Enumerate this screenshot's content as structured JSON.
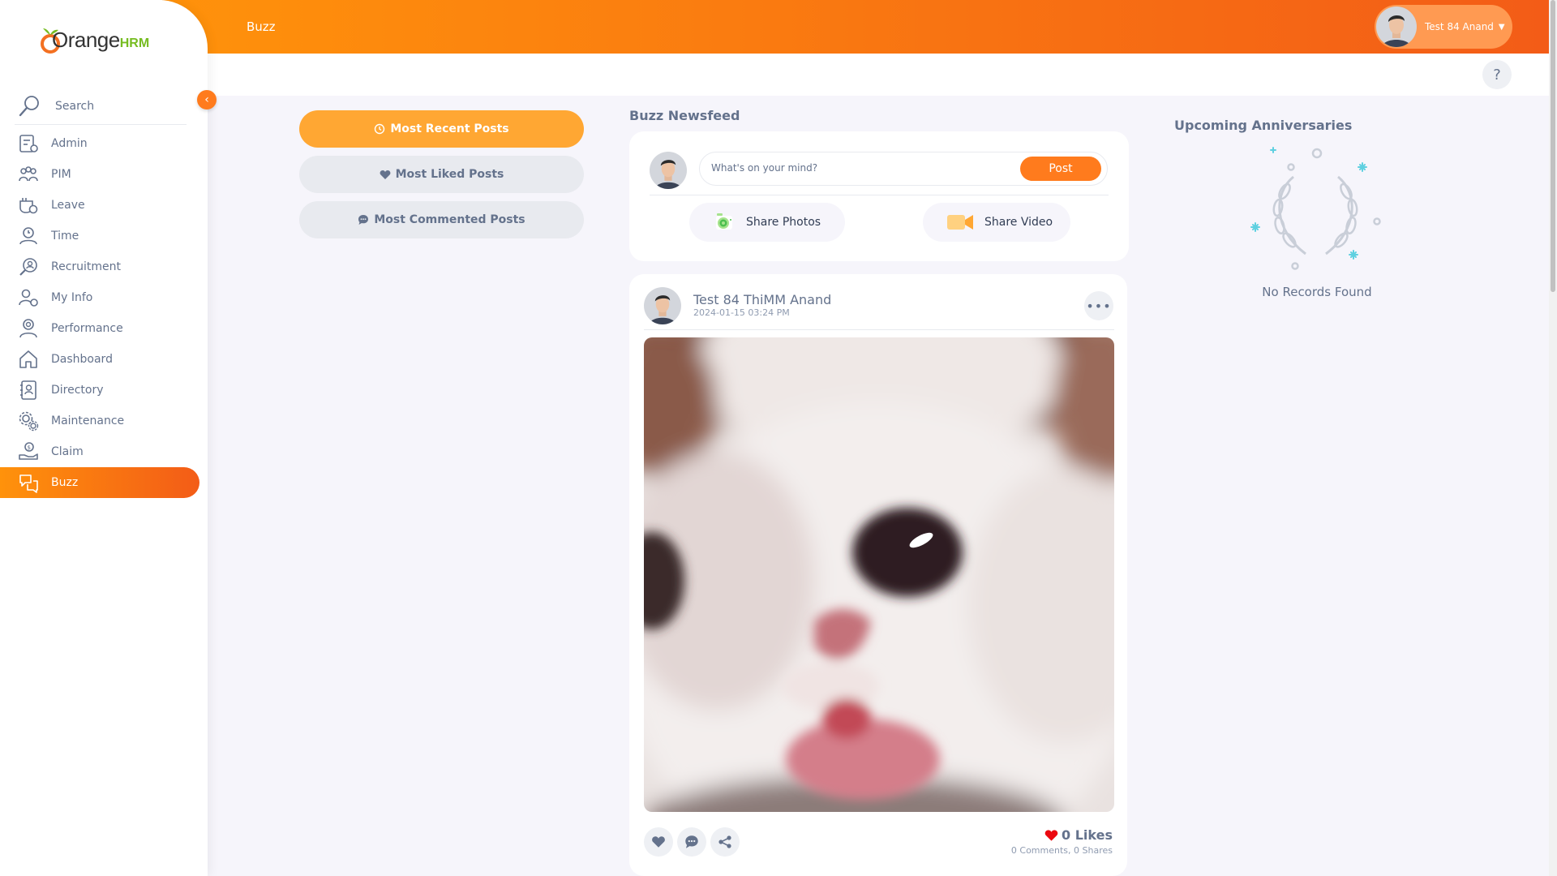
{
  "brand": {
    "part1": "Orange",
    "part2": "HRM"
  },
  "sidebar": {
    "search_placeholder": "Search",
    "items": [
      {
        "label": "Admin",
        "icon": "admin-icon"
      },
      {
        "label": "PIM",
        "icon": "pim-icon"
      },
      {
        "label": "Leave",
        "icon": "leave-icon"
      },
      {
        "label": "Time",
        "icon": "time-icon"
      },
      {
        "label": "Recruitment",
        "icon": "recruitment-icon"
      },
      {
        "label": "My Info",
        "icon": "my-info-icon"
      },
      {
        "label": "Performance",
        "icon": "performance-icon"
      },
      {
        "label": "Dashboard",
        "icon": "dashboard-icon"
      },
      {
        "label": "Directory",
        "icon": "directory-icon"
      },
      {
        "label": "Maintenance",
        "icon": "maintenance-icon"
      },
      {
        "label": "Claim",
        "icon": "claim-icon"
      },
      {
        "label": "Buzz",
        "icon": "buzz-icon",
        "active": true
      }
    ]
  },
  "topbar": {
    "title": "Buzz",
    "user_name": "Test 84 Anand"
  },
  "help_label": "?",
  "filters": {
    "most_recent": "Most Recent Posts",
    "most_liked": "Most Liked Posts",
    "most_commented": "Most Commented Posts"
  },
  "feed": {
    "title": "Buzz Newsfeed",
    "input_placeholder": "What's on your mind?",
    "post_button": "Post",
    "share_photos": "Share Photos",
    "share_video": "Share Video"
  },
  "post": {
    "author": "Test 84 ThiMM Anand",
    "time": "2024-01-15 03:24 PM",
    "likes": "0 Likes",
    "comments": "0 Comments",
    "shares": "0 Shares"
  },
  "anniversaries": {
    "title": "Upcoming Anniversaries",
    "empty": "No Records Found"
  },
  "colors": {
    "accent": "#ff7b1d",
    "gradient_start": "#ff920b",
    "gradient_end": "#f35c17",
    "filter_active": "#ffa733",
    "text": "#64728c"
  }
}
